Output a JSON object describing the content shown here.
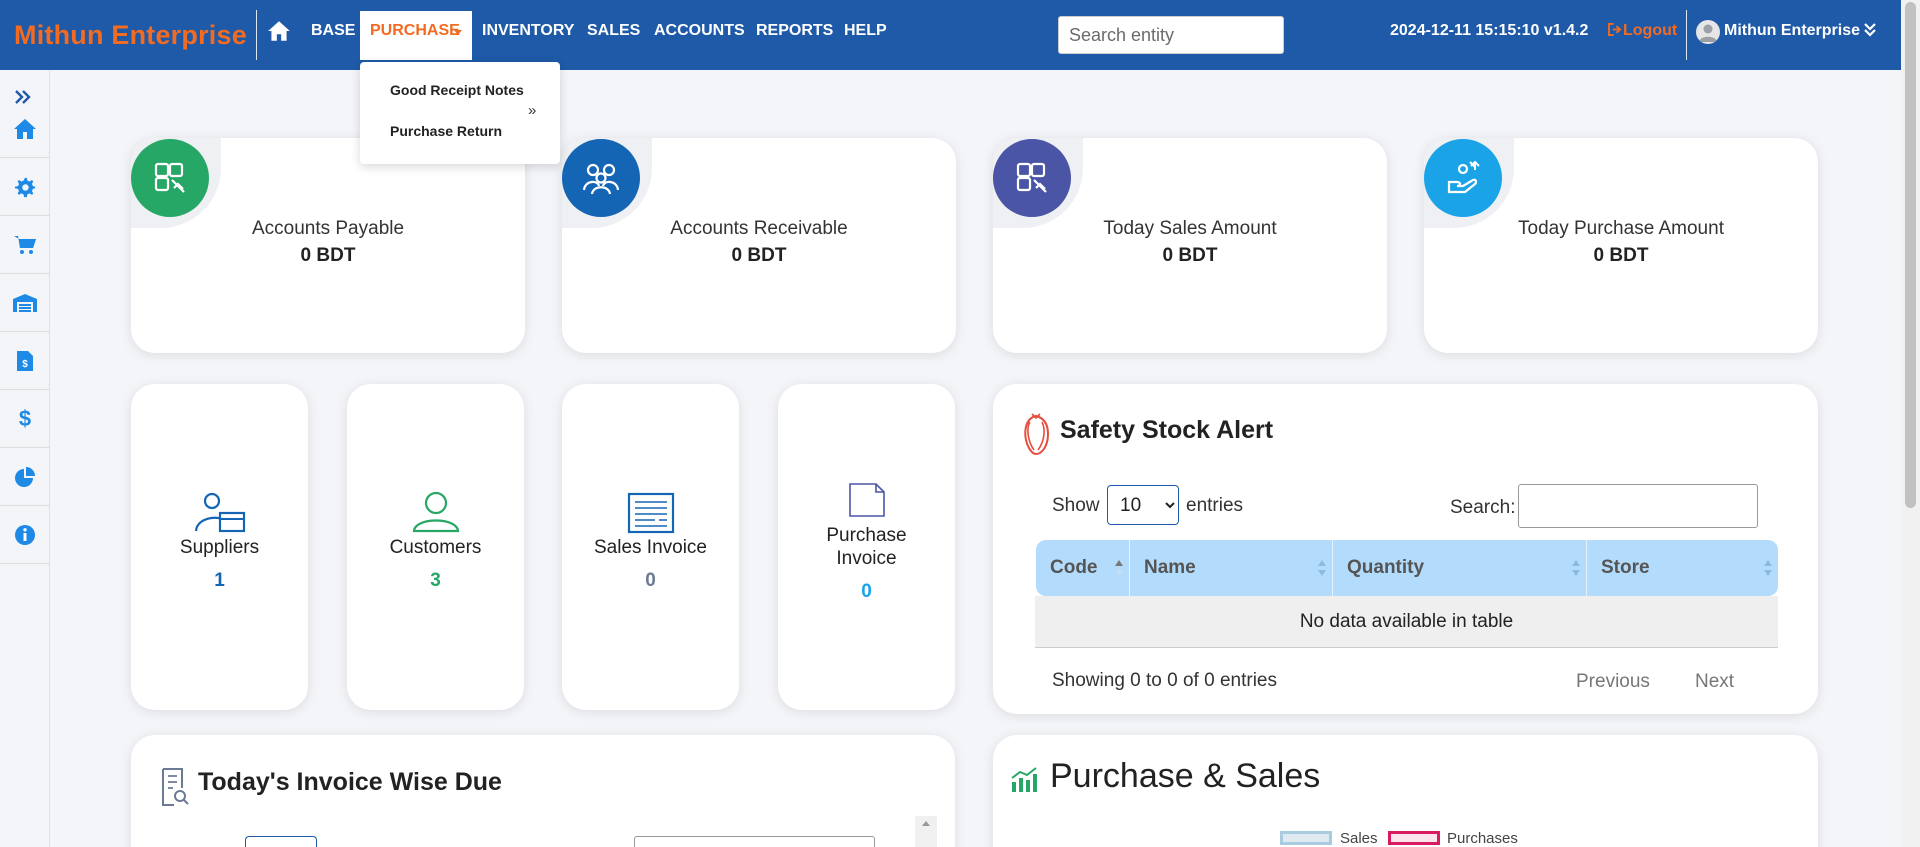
{
  "brand": {
    "name": "Mithun Enterprise"
  },
  "nav": {
    "items": [
      {
        "label": "BASE"
      },
      {
        "label": "PURCHASE"
      },
      {
        "label": "INVENTORY"
      },
      {
        "label": "SALES"
      },
      {
        "label": "ACCOUNTS"
      },
      {
        "label": "REPORTS"
      },
      {
        "label": "HELP"
      }
    ],
    "active_index": 1,
    "search_placeholder": "Search entity",
    "datetime_version": "2024-12-11 15:15:10 v1.4.2",
    "logout_label": "Logout",
    "user_name": "Mithun Enterprise"
  },
  "purchase_menu": {
    "items": [
      {
        "label": "Good Receipt Notes"
      },
      {
        "label": "Purchase Return"
      }
    ],
    "submenu_indicator": "»"
  },
  "sidebar": {
    "expand_icon": "double-chevron-right-icon",
    "icons": [
      "home-icon",
      "gear-icon",
      "cart-icon",
      "warehouse-icon",
      "invoice-icon",
      "dollar-icon",
      "pie-chart-icon",
      "info-icon"
    ],
    "accent_color": "#1e8ae6"
  },
  "stats": [
    {
      "title": "Accounts Payable",
      "value": "0 BDT",
      "color": "#27a765",
      "icon": "puzzle-hand-icon"
    },
    {
      "title": "Accounts Receivable",
      "value": "0 BDT",
      "color": "#1565b5",
      "icon": "people-icon"
    },
    {
      "title": "Today Sales Amount",
      "value": "0 BDT",
      "color": "#4a55a5",
      "icon": "puzzle-hand-icon"
    },
    {
      "title": "Today Purchase Amount",
      "value": "0 BDT",
      "color": "#1ba3e8",
      "icon": "hand-coins-icon"
    }
  ],
  "counts": [
    {
      "title": "Suppliers",
      "value": "1",
      "color": "#1565b5",
      "icon": "supplier-icon"
    },
    {
      "title": "Customers",
      "value": "3",
      "color": "#27a765",
      "icon": "user-icon"
    },
    {
      "title": "Sales Invoice",
      "value": "0",
      "color": "#6c7a95",
      "icon": "invoice-doc-icon"
    },
    {
      "title": "Purchase Invoice",
      "value": "0",
      "color": "#1ba3e8",
      "icon": "document-icon"
    }
  ],
  "safety_stock": {
    "title": "Safety Stock Alert",
    "show_label": "Show",
    "entries_label": "entries",
    "page_length": "10",
    "search_label": "Search:",
    "columns": [
      "Code",
      "Name",
      "Quantity",
      "Store"
    ],
    "empty_message": "No data available in table",
    "info": "Showing 0 to 0 of 0 entries",
    "previous_label": "Previous",
    "next_label": "Next"
  },
  "invoice_due": {
    "title": "Today's Invoice Wise Due"
  },
  "purchase_sales": {
    "title": "Purchase & Sales",
    "legend": [
      {
        "name": "Sales",
        "color": "#a8cbe0"
      },
      {
        "name": "Purchases",
        "color": "#d81b60"
      }
    ]
  }
}
